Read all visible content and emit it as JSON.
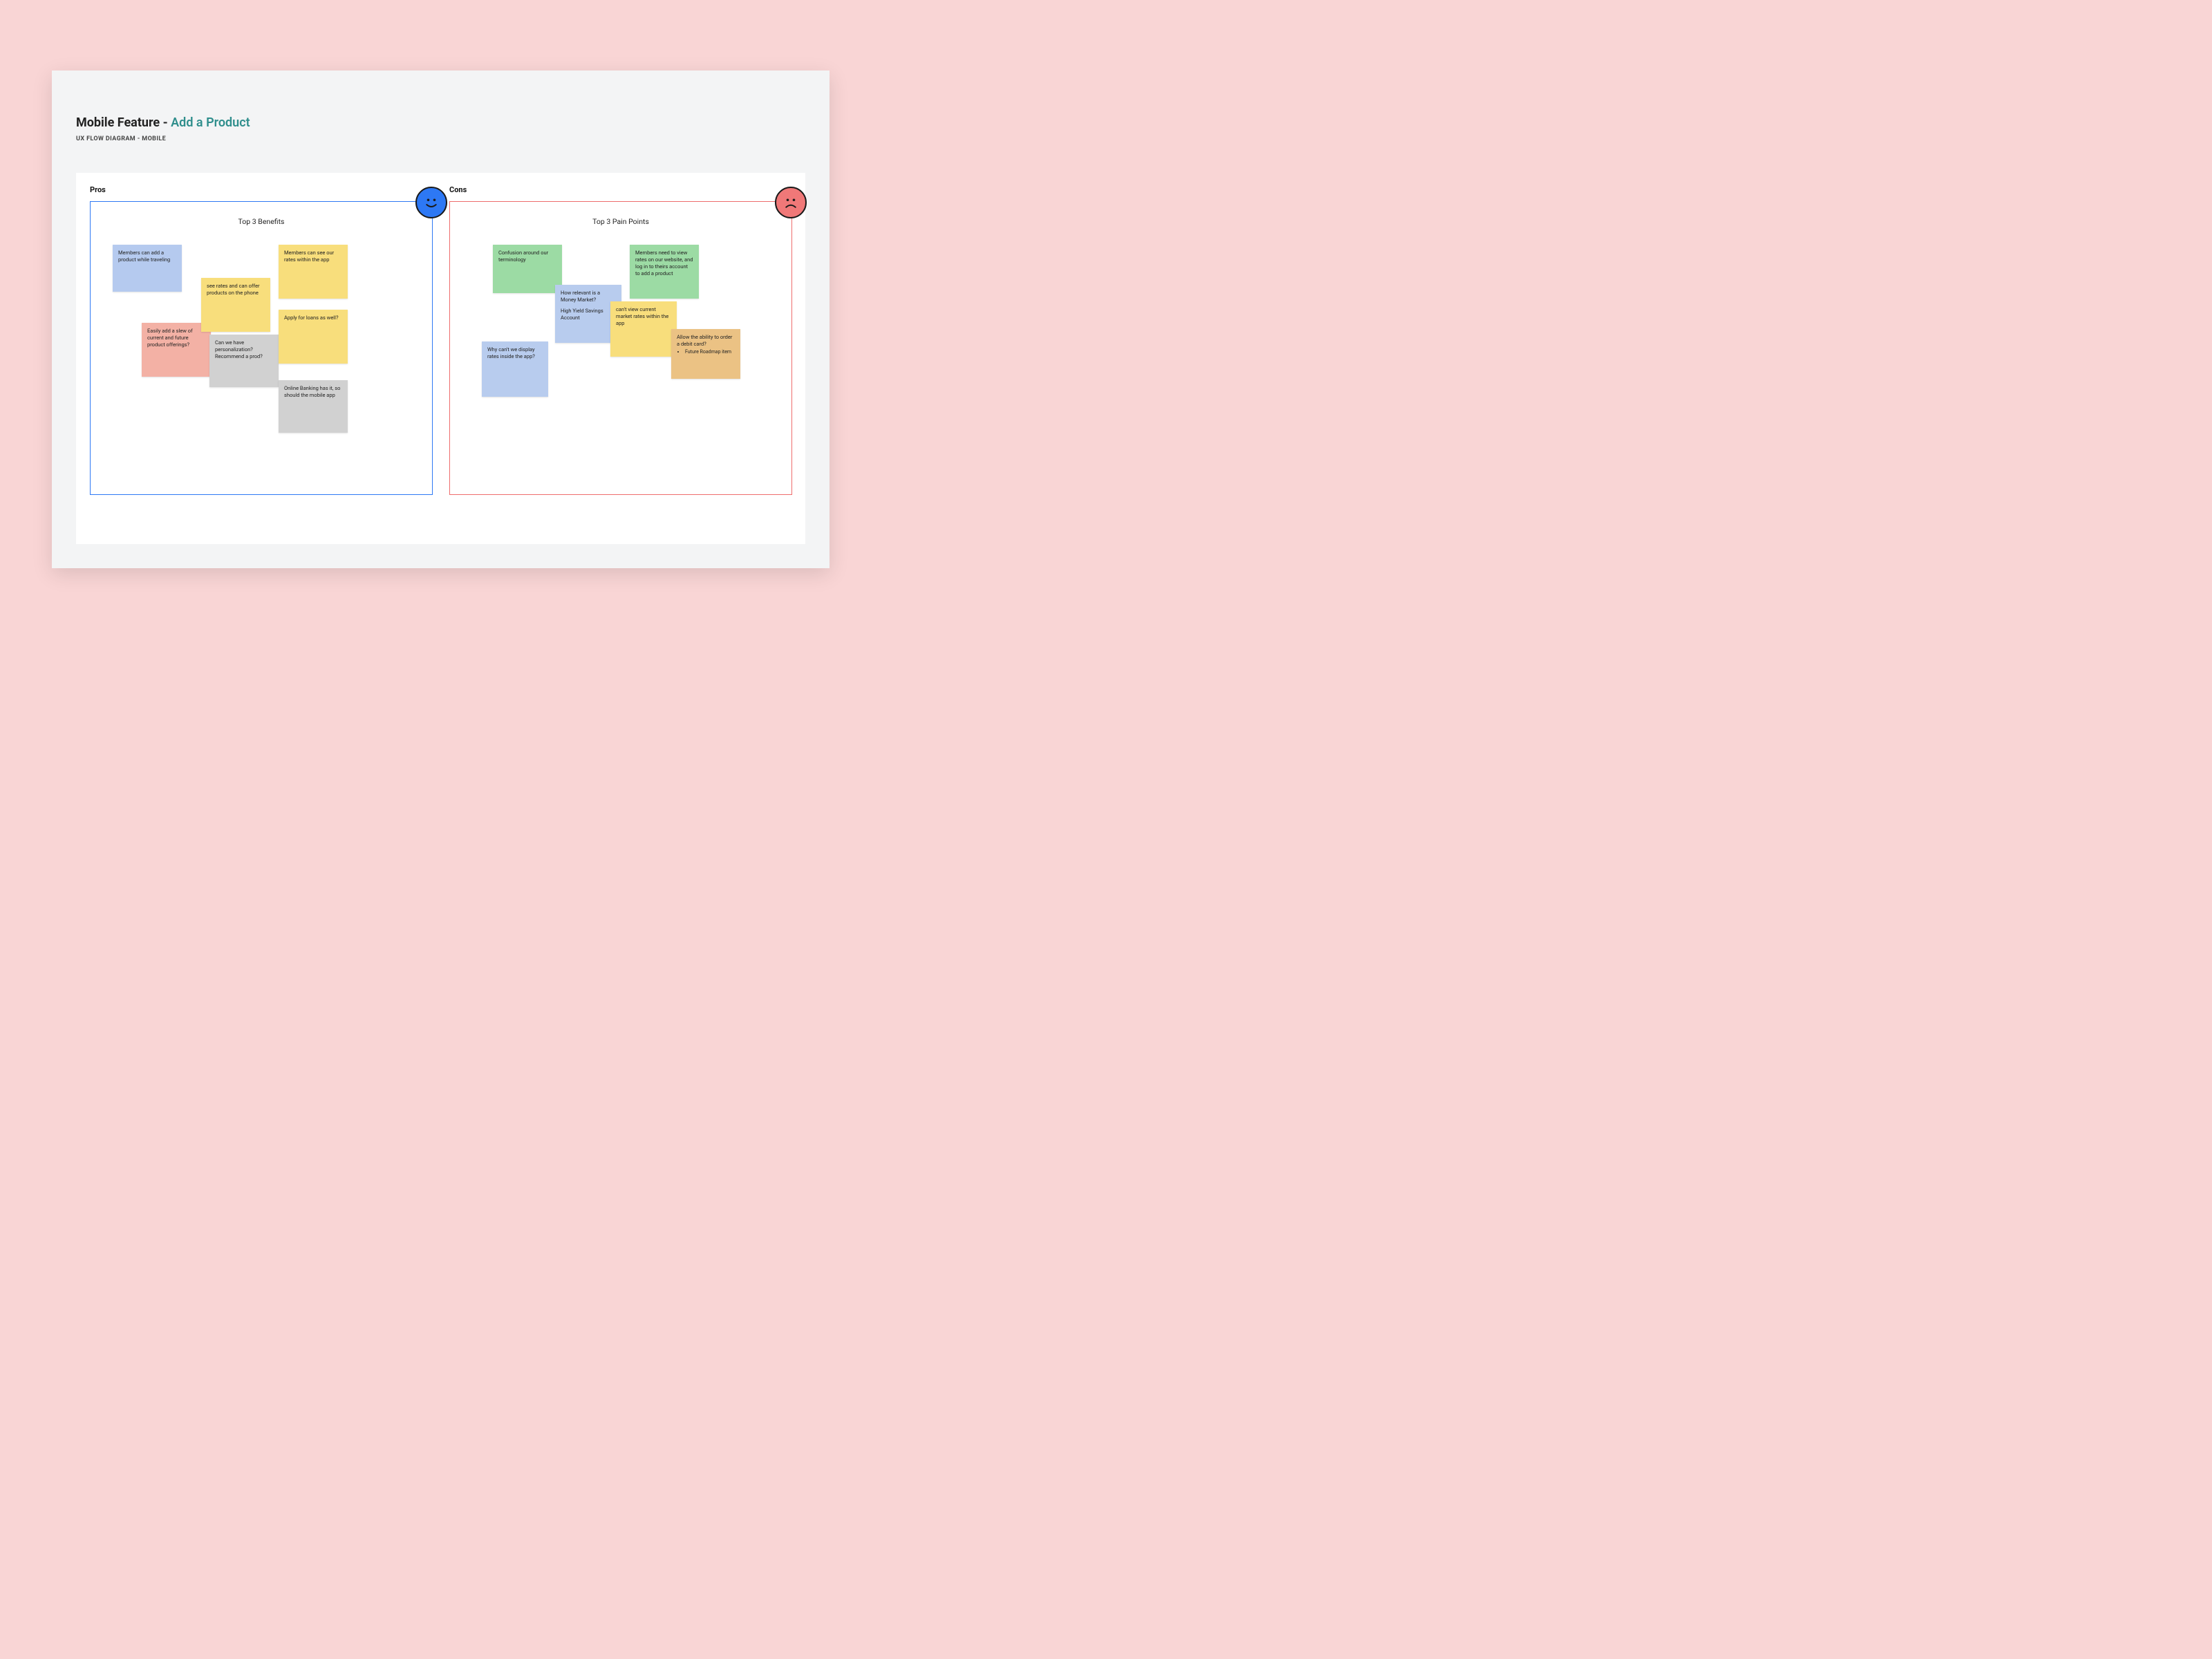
{
  "header": {
    "title_prefix": "Mobile Feature - ",
    "title_accent": "Add a Product",
    "subtitle": "UX FLOW DIAGRAM - MOBILE"
  },
  "pros": {
    "label": "Pros",
    "frame_title": "Top 3 Benefits",
    "face_icon": "smile-icon",
    "notes": {
      "n1": "Members can add a product while traveling",
      "n2": "Easily add a slew of current and future product offerings?",
      "n3": "see rates and can offer products on the phone",
      "n4": "Can we have personalization? Recommend a prod?",
      "n5": "Members can see our rates within the app",
      "n6": "Apply for loans as well?",
      "n7": "Online Banking has it, so should the mobile app"
    }
  },
  "cons": {
    "label": "Cons",
    "frame_title": "Top 3 Pain Points",
    "face_icon": "frown-icon",
    "notes": {
      "n1": "Confusion around our terminology",
      "n2_a": "How relevant is a Money Market?",
      "n2_b": "High Yield Savings Account",
      "n3": "Why can't we display rates inside the app?",
      "n4": "can't view current market rates within the app",
      "n5": "Members need to view rates on our website, and log in to theirs account to add a product",
      "n6_a": "Allow the ability to order a debit card?",
      "n6_b": "Future Roadmap item"
    }
  },
  "colors": {
    "frame_blue": "#2D78F4",
    "frame_red": "#EE6C6C",
    "face_happy": "#2D78F4",
    "face_sad": "#F07878",
    "accent_text": "#2F8E8C",
    "bg_page": "#F9D5D5",
    "bg_stage": "#F3F4F5"
  }
}
